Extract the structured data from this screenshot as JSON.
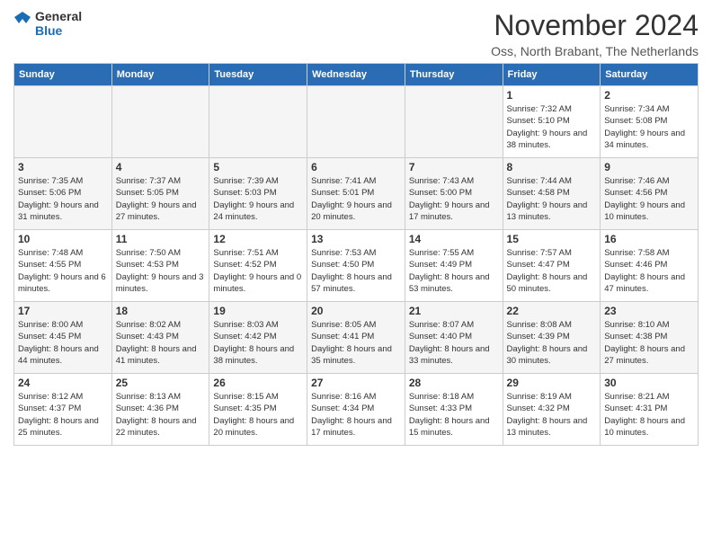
{
  "header": {
    "logo_line1": "General",
    "logo_line2": "Blue",
    "month_title": "November 2024",
    "location": "Oss, North Brabant, The Netherlands"
  },
  "weekdays": [
    "Sunday",
    "Monday",
    "Tuesday",
    "Wednesday",
    "Thursday",
    "Friday",
    "Saturday"
  ],
  "weeks": [
    [
      {
        "day": "",
        "info": ""
      },
      {
        "day": "",
        "info": ""
      },
      {
        "day": "",
        "info": ""
      },
      {
        "day": "",
        "info": ""
      },
      {
        "day": "",
        "info": ""
      },
      {
        "day": "1",
        "info": "Sunrise: 7:32 AM\nSunset: 5:10 PM\nDaylight: 9 hours and 38 minutes."
      },
      {
        "day": "2",
        "info": "Sunrise: 7:34 AM\nSunset: 5:08 PM\nDaylight: 9 hours and 34 minutes."
      }
    ],
    [
      {
        "day": "3",
        "info": "Sunrise: 7:35 AM\nSunset: 5:06 PM\nDaylight: 9 hours and 31 minutes."
      },
      {
        "day": "4",
        "info": "Sunrise: 7:37 AM\nSunset: 5:05 PM\nDaylight: 9 hours and 27 minutes."
      },
      {
        "day": "5",
        "info": "Sunrise: 7:39 AM\nSunset: 5:03 PM\nDaylight: 9 hours and 24 minutes."
      },
      {
        "day": "6",
        "info": "Sunrise: 7:41 AM\nSunset: 5:01 PM\nDaylight: 9 hours and 20 minutes."
      },
      {
        "day": "7",
        "info": "Sunrise: 7:43 AM\nSunset: 5:00 PM\nDaylight: 9 hours and 17 minutes."
      },
      {
        "day": "8",
        "info": "Sunrise: 7:44 AM\nSunset: 4:58 PM\nDaylight: 9 hours and 13 minutes."
      },
      {
        "day": "9",
        "info": "Sunrise: 7:46 AM\nSunset: 4:56 PM\nDaylight: 9 hours and 10 minutes."
      }
    ],
    [
      {
        "day": "10",
        "info": "Sunrise: 7:48 AM\nSunset: 4:55 PM\nDaylight: 9 hours and 6 minutes."
      },
      {
        "day": "11",
        "info": "Sunrise: 7:50 AM\nSunset: 4:53 PM\nDaylight: 9 hours and 3 minutes."
      },
      {
        "day": "12",
        "info": "Sunrise: 7:51 AM\nSunset: 4:52 PM\nDaylight: 9 hours and 0 minutes."
      },
      {
        "day": "13",
        "info": "Sunrise: 7:53 AM\nSunset: 4:50 PM\nDaylight: 8 hours and 57 minutes."
      },
      {
        "day": "14",
        "info": "Sunrise: 7:55 AM\nSunset: 4:49 PM\nDaylight: 8 hours and 53 minutes."
      },
      {
        "day": "15",
        "info": "Sunrise: 7:57 AM\nSunset: 4:47 PM\nDaylight: 8 hours and 50 minutes."
      },
      {
        "day": "16",
        "info": "Sunrise: 7:58 AM\nSunset: 4:46 PM\nDaylight: 8 hours and 47 minutes."
      }
    ],
    [
      {
        "day": "17",
        "info": "Sunrise: 8:00 AM\nSunset: 4:45 PM\nDaylight: 8 hours and 44 minutes."
      },
      {
        "day": "18",
        "info": "Sunrise: 8:02 AM\nSunset: 4:43 PM\nDaylight: 8 hours and 41 minutes."
      },
      {
        "day": "19",
        "info": "Sunrise: 8:03 AM\nSunset: 4:42 PM\nDaylight: 8 hours and 38 minutes."
      },
      {
        "day": "20",
        "info": "Sunrise: 8:05 AM\nSunset: 4:41 PM\nDaylight: 8 hours and 35 minutes."
      },
      {
        "day": "21",
        "info": "Sunrise: 8:07 AM\nSunset: 4:40 PM\nDaylight: 8 hours and 33 minutes."
      },
      {
        "day": "22",
        "info": "Sunrise: 8:08 AM\nSunset: 4:39 PM\nDaylight: 8 hours and 30 minutes."
      },
      {
        "day": "23",
        "info": "Sunrise: 8:10 AM\nSunset: 4:38 PM\nDaylight: 8 hours and 27 minutes."
      }
    ],
    [
      {
        "day": "24",
        "info": "Sunrise: 8:12 AM\nSunset: 4:37 PM\nDaylight: 8 hours and 25 minutes."
      },
      {
        "day": "25",
        "info": "Sunrise: 8:13 AM\nSunset: 4:36 PM\nDaylight: 8 hours and 22 minutes."
      },
      {
        "day": "26",
        "info": "Sunrise: 8:15 AM\nSunset: 4:35 PM\nDaylight: 8 hours and 20 minutes."
      },
      {
        "day": "27",
        "info": "Sunrise: 8:16 AM\nSunset: 4:34 PM\nDaylight: 8 hours and 17 minutes."
      },
      {
        "day": "28",
        "info": "Sunrise: 8:18 AM\nSunset: 4:33 PM\nDaylight: 8 hours and 15 minutes."
      },
      {
        "day": "29",
        "info": "Sunrise: 8:19 AM\nSunset: 4:32 PM\nDaylight: 8 hours and 13 minutes."
      },
      {
        "day": "30",
        "info": "Sunrise: 8:21 AM\nSunset: 4:31 PM\nDaylight: 8 hours and 10 minutes."
      }
    ]
  ]
}
